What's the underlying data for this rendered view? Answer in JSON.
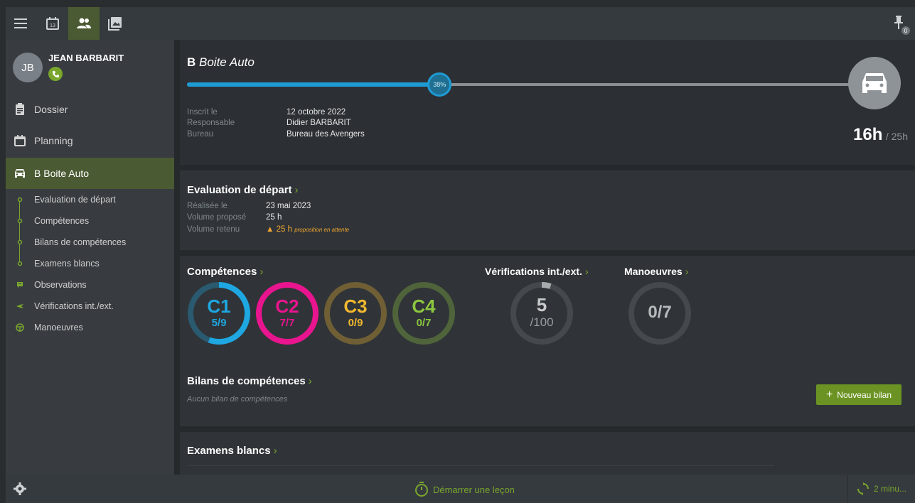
{
  "topbar": {
    "menu_icon": "menu-icon",
    "calendar_icon_day": "13",
    "people_icon": "people-icon",
    "gallery_icon": "gallery-icon",
    "pin_badge": "0"
  },
  "sidebar": {
    "avatar_initials": "JB",
    "user_name": "JEAN BARBARIT",
    "nav": [
      {
        "label": "Dossier",
        "icon": "clipboard-icon"
      },
      {
        "label": "Planning",
        "icon": "calendar-icon"
      },
      {
        "label": "B Boite Auto",
        "icon": "car-icon"
      }
    ],
    "subitems": [
      {
        "label": "Evaluation de départ"
      },
      {
        "label": "Compétences"
      },
      {
        "label": "Bilans de compétences"
      },
      {
        "label": "Examens blancs"
      },
      {
        "label": "Observations"
      },
      {
        "label": "Vérifications int./ext."
      },
      {
        "label": "Manoeuvres"
      }
    ]
  },
  "formation": {
    "title_bold": "B",
    "title_italic": "Boite Auto",
    "progress_percent": 38,
    "progress_label": "38%",
    "hours_done": "16h",
    "hours_total": "/ 25h",
    "fields": [
      {
        "key": "Inscrit le",
        "value": "12 octobre 2022"
      },
      {
        "key": "Responsable",
        "value": "Didier BARBARIT"
      },
      {
        "key": "Bureau",
        "value": "Bureau des Avengers"
      }
    ]
  },
  "evaluation": {
    "title": "Evaluation de départ",
    "fields": [
      {
        "key": "Réalisée le",
        "value": "23 mai 2023"
      },
      {
        "key": "Volume proposé",
        "value": "25 h"
      },
      {
        "key": "Volume retenu",
        "value": "25 h",
        "note": "proposition en attente"
      }
    ]
  },
  "competences": {
    "title": "Compétences",
    "rings": [
      {
        "code": "C1",
        "frac": "5/9",
        "done": 5,
        "total": 9,
        "color": "#1ea7e1"
      },
      {
        "code": "C2",
        "frac": "7/7",
        "done": 7,
        "total": 7,
        "color": "#e8158e"
      },
      {
        "code": "C3",
        "frac": "0/9",
        "done": 0,
        "total": 9,
        "color": "#f0b72f"
      },
      {
        "code": "C4",
        "frac": "0/7",
        "done": 0,
        "total": 7,
        "color": "#8cc63f"
      }
    ],
    "verifications_title": "Vérifications int./ext.",
    "verifications_value": "5",
    "verifications_total": "/100",
    "verifications_done": 5,
    "manoeuvres_title": "Manoeuvres",
    "manoeuvres_value": "0/7"
  },
  "bilans": {
    "title": "Bilans de compétences",
    "empty": "Aucun bilan de compétences",
    "new_button": "Nouveau bilan"
  },
  "examens": {
    "title": "Examens blancs"
  },
  "bottombar": {
    "start_label": "Démarrer une leçon",
    "sync_label": "2 minu..."
  }
}
